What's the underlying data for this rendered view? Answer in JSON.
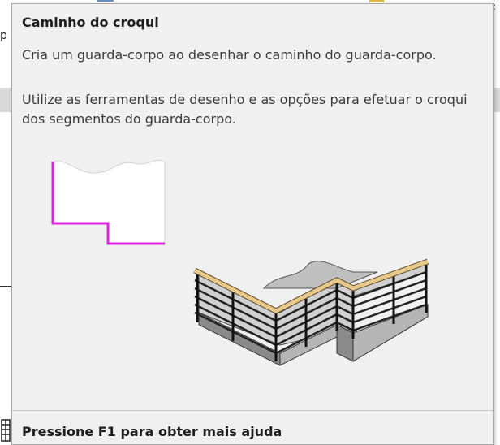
{
  "background": {
    "fragment_left": "p",
    "fragment_right": "e"
  },
  "tooltip": {
    "title": "Caminho do croqui",
    "description": "Cria um guarda-corpo ao desenhar o caminho do guarda-corpo.",
    "detail": "Utilize as ferramentas de desenho e as opções para efetuar o croqui dos segmentos do guarda-corpo.",
    "footer": "Pressione F1 para obter mais ajuda",
    "figures": {
      "sketch_path_icon": "sketch-path-diagram",
      "railing_icon": "railing-3d-illustration"
    }
  },
  "colors": {
    "sketch_line": "#e020e0",
    "handrail": "#e6c98a",
    "tooltip_bg": "#f0f0f0"
  }
}
